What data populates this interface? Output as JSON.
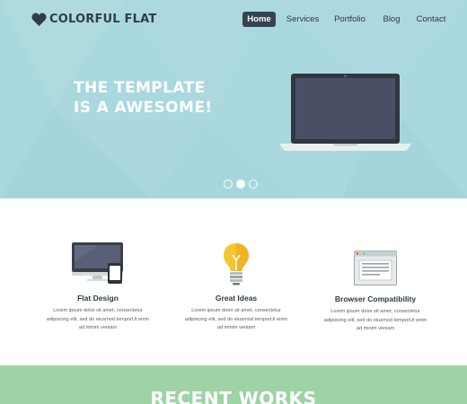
{
  "brand": {
    "name": "COLORFUL FLAT",
    "logo_icon": "heart-icon"
  },
  "nav": {
    "items": [
      {
        "label": "Home",
        "active": true
      },
      {
        "label": "Services",
        "active": false
      },
      {
        "label": "Portfolio",
        "active": false
      },
      {
        "label": "Blog",
        "active": false
      },
      {
        "label": "Contact",
        "active": false
      }
    ]
  },
  "hero": {
    "title_line1": "THE TEMPLATE",
    "title_line2": "IS A AWESOME!",
    "slides_total": 3,
    "active_slide": 2
  },
  "features": [
    {
      "icon": "desktop-tablet-icon",
      "title": "Flat Design",
      "desc_lines": [
        "Lorem ipsum dolor sit amet, consectetur",
        "adipiscing elit, sed do eiusmod temporUt enim",
        "ad minim veniam"
      ]
    },
    {
      "icon": "lightbulb-icon",
      "title": "Great Ideas",
      "desc_lines": [
        "Lorem ipsum dolor sit amet, consectetur",
        "adipiscing elit, sed do eiusmod temporUt enim",
        "ad minim veniam"
      ]
    },
    {
      "icon": "browser-window-icon",
      "title": "Browser Compatibility",
      "desc_lines": [
        "Lorem ipsum dolor sit amet, consectetur",
        "adipiscing elit, sed do eiusmod temporUt enim",
        "ad minim veniam"
      ]
    }
  ],
  "recent": {
    "title": "RECENT WORKS"
  },
  "colors": {
    "hero_bg": "#a9d8de",
    "nav_active_bg": "#34444e",
    "text_dark": "#2d3a42",
    "recent_bg": "#9ed3a5",
    "bulb_yellow": "#f5c62e",
    "screen_dark": "#4a4f66"
  }
}
